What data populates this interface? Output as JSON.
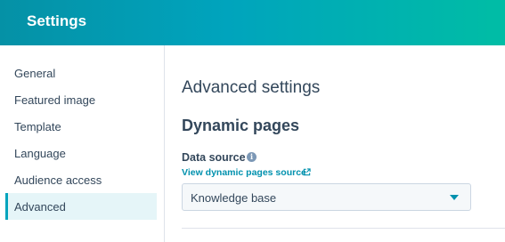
{
  "header": {
    "title": "Settings"
  },
  "sidebar": {
    "items": [
      {
        "label": "General"
      },
      {
        "label": "Featured image"
      },
      {
        "label": "Template"
      },
      {
        "label": "Language"
      },
      {
        "label": "Audience access"
      },
      {
        "label": "Advanced",
        "active": true
      }
    ]
  },
  "main": {
    "heading": "Advanced settings",
    "section_heading": "Dynamic pages",
    "data_source": {
      "label": "Data source",
      "info_icon": "info-icon",
      "link_text": "View dynamic pages source",
      "link_icon": "external-link-icon",
      "selected_value": "Knowledge base"
    }
  },
  "colors": {
    "accent": "#00a4bd",
    "link": "#0091ae",
    "text": "#33475b",
    "active_bg": "#e5f5f8"
  }
}
